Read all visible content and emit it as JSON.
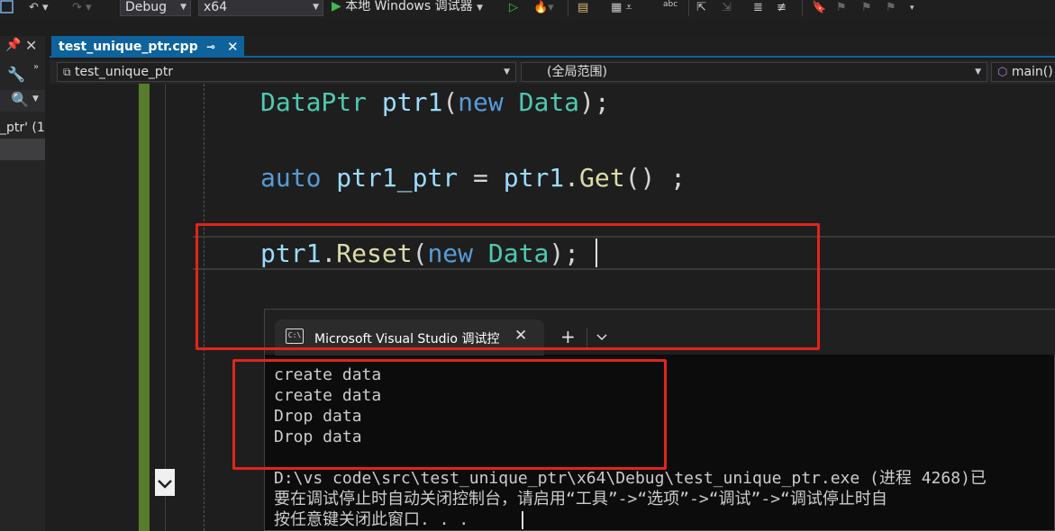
{
  "toolbar": {
    "config": "Debug",
    "platform": "x64",
    "run_label": "本地 Windows 调试器"
  },
  "left_panel": {
    "search_item": "_ptr' (1"
  },
  "tab": {
    "filename": "test_unique_ptr.cpp"
  },
  "navbar": {
    "project": "test_unique_ptr",
    "scope": "(全局范围)",
    "member": "main()"
  },
  "code": {
    "line1": {
      "type": "DataPtr",
      "var": "ptr1",
      "open": "(",
      "kw": "new",
      "arg": "Data",
      "close": ");"
    },
    "line2": {
      "kw": "auto",
      "var": "ptr1_ptr",
      "eq": "=",
      "obj": "ptr1",
      "dot": ".",
      "fn": "Get",
      "tail": "() ;"
    },
    "line3": {
      "obj": "ptr1",
      "dot": ".",
      "fn": "Reset",
      "open": "(",
      "kw": "new",
      "arg": "Data",
      "close": ");"
    }
  },
  "console": {
    "tab_title": "Microsoft Visual Studio 调试控",
    "lines": [
      "create data",
      "create data",
      "Drop data",
      "Drop data"
    ],
    "path_line": "D:\\vs code\\src\\test_unique_ptr\\x64\\Debug\\test_unique_ptr.exe (进程 4268)已",
    "hint_line": "要在调试停止时自动关闭控制台，请启用“工具”->“选项”->“调试”->“调试停止时自",
    "press_line": "按任意键关闭此窗口. . ."
  },
  "colors": {
    "accent": "#0e639c",
    "highlight_box": "#e0251b",
    "change_bar": "#577c2b"
  }
}
